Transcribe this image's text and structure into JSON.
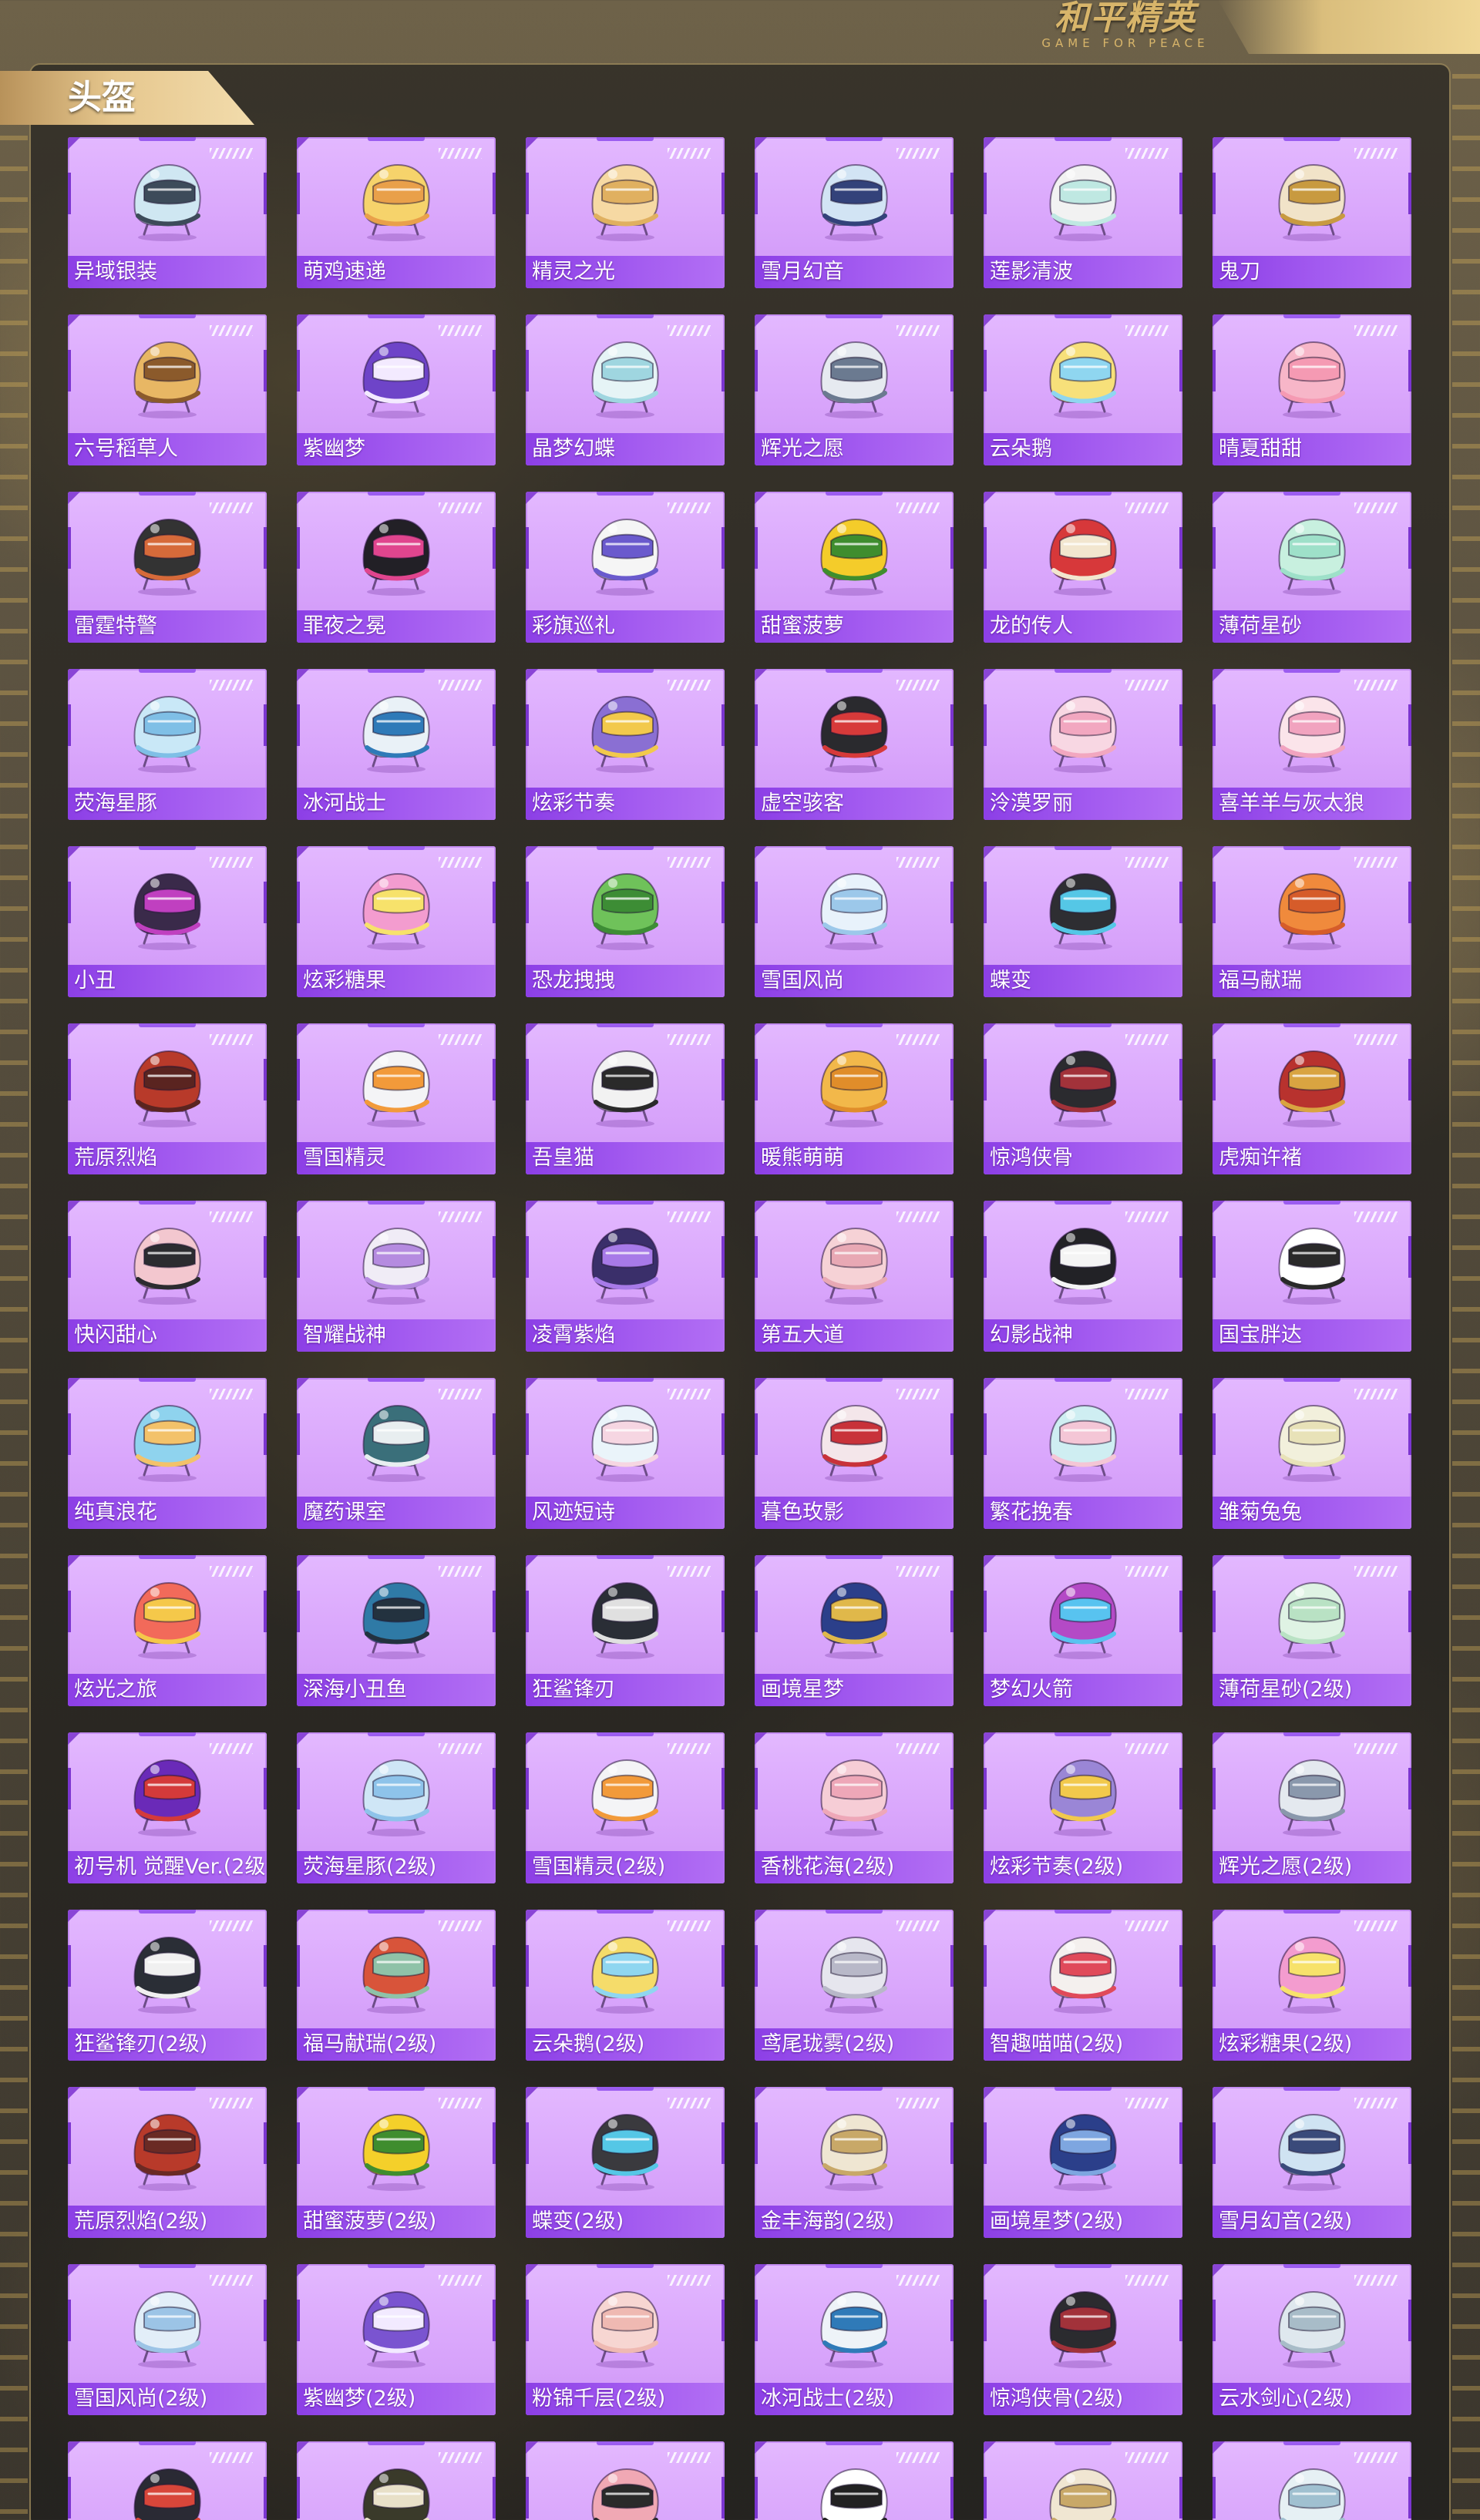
{
  "logo": {
    "title": "和平精英",
    "subtitle": "GAME FOR PEACE"
  },
  "section": {
    "title": "头盔"
  },
  "helmets": [
    {
      "name": "异域银装",
      "colors": [
        "#cfe7f2",
        "#3d4b5a"
      ]
    },
    {
      "name": "萌鸡速递",
      "colors": [
        "#f6d36b",
        "#e9a04a"
      ]
    },
    {
      "name": "精灵之光",
      "colors": [
        "#f6d9a3",
        "#e0b060"
      ]
    },
    {
      "name": "雪月幻音",
      "colors": [
        "#d2e4f4",
        "#33427a"
      ]
    },
    {
      "name": "莲影清波",
      "colors": [
        "#f2f2f2",
        "#bfe8e2"
      ]
    },
    {
      "name": "鬼刀",
      "colors": [
        "#f1e3c8",
        "#c89a40"
      ]
    },
    {
      "name": "六号稻草人",
      "colors": [
        "#e8b764",
        "#8b5a2b"
      ]
    },
    {
      "name": "紫幽梦",
      "colors": [
        "#6e44c8",
        "#f3eaff"
      ]
    },
    {
      "name": "晶梦幻蝶",
      "colors": [
        "#e6f4f6",
        "#9fd6e0"
      ]
    },
    {
      "name": "辉光之愿",
      "colors": [
        "#e6eaf0",
        "#6b7a90"
      ]
    },
    {
      "name": "云朵鹅",
      "colors": [
        "#f7e07a",
        "#8fd6f0"
      ]
    },
    {
      "name": "晴夏甜甜",
      "colors": [
        "#f7b6c8",
        "#f59ab3"
      ]
    },
    {
      "name": "雷霆特警",
      "colors": [
        "#333333",
        "#d66a3a"
      ]
    },
    {
      "name": "罪夜之冕",
      "colors": [
        "#222026",
        "#e0458e"
      ]
    },
    {
      "name": "彩旗巡礼",
      "colors": [
        "#f5f5f5",
        "#6a5acd"
      ]
    },
    {
      "name": "甜蜜菠萝",
      "colors": [
        "#f4cc2a",
        "#3f8d2e"
      ]
    },
    {
      "name": "龙的传人",
      "colors": [
        "#d7383a",
        "#f2e6cf"
      ]
    },
    {
      "name": "薄荷星砂",
      "colors": [
        "#c8f0df",
        "#9ee0c9"
      ]
    },
    {
      "name": "荧海星豚",
      "colors": [
        "#c9e8f7",
        "#7fbfe6"
      ]
    },
    {
      "name": "冰河战士",
      "colors": [
        "#e9f1f7",
        "#2f7ab8"
      ]
    },
    {
      "name": "炫彩节奏",
      "colors": [
        "#8a6fd3",
        "#f2c94c"
      ]
    },
    {
      "name": "虚空骇客",
      "colors": [
        "#2a2a2e",
        "#d73a3a"
      ]
    },
    {
      "name": "泠漠罗丽",
      "colors": [
        "#f8d7e3",
        "#f2a7c0"
      ]
    },
    {
      "name": "喜羊羊与灰太狼",
      "colors": [
        "#fbe4ea",
        "#f1a3bf"
      ]
    },
    {
      "name": "小丑",
      "colors": [
        "#3a2a4a",
        "#c040c0"
      ]
    },
    {
      "name": "炫彩糖果",
      "colors": [
        "#f39ccf",
        "#f7e26b"
      ]
    },
    {
      "name": "恐龙拽拽",
      "colors": [
        "#6fc25a",
        "#3d8d35"
      ]
    },
    {
      "name": "雪国风尚",
      "colors": [
        "#e8f2fb",
        "#9cc8ea"
      ]
    },
    {
      "name": "蝶变",
      "colors": [
        "#2e2e32",
        "#55c7e6"
      ]
    },
    {
      "name": "福马献瑞",
      "colors": [
        "#f08a3c",
        "#d65c2a"
      ]
    },
    {
      "name": "荒原烈焰",
      "colors": [
        "#b83a2a",
        "#5a2420"
      ]
    },
    {
      "name": "雪国精灵",
      "colors": [
        "#f4f4f6",
        "#f29a3a"
      ]
    },
    {
      "name": "吾皇猫",
      "colors": [
        "#f2f2f2",
        "#2a2a2a"
      ]
    },
    {
      "name": "暖熊萌萌",
      "colors": [
        "#f2b84a",
        "#e08d2a"
      ]
    },
    {
      "name": "惊鸿侠骨",
      "colors": [
        "#2b2b2f",
        "#a2323a"
      ]
    },
    {
      "name": "虎痴许褚",
      "colors": [
        "#b8322e",
        "#d9a441"
      ]
    },
    {
      "name": "快闪甜心",
      "colors": [
        "#f3c7cf",
        "#2c2c30"
      ]
    },
    {
      "name": "智耀战神",
      "colors": [
        "#f0ecf6",
        "#b58be0"
      ]
    },
    {
      "name": "凌霄紫焰",
      "colors": [
        "#3a2f6a",
        "#a77ae8"
      ]
    },
    {
      "name": "第五大道",
      "colors": [
        "#f6d2d6",
        "#e8a8b4"
      ]
    },
    {
      "name": "幻影战神",
      "colors": [
        "#222226",
        "#f4f4f4"
      ]
    },
    {
      "name": "国宝胖达",
      "colors": [
        "#ffffff",
        "#2a2a2a"
      ]
    },
    {
      "name": "纯真浪花",
      "colors": [
        "#8fd3ee",
        "#f3c26a"
      ]
    },
    {
      "name": "魔药课室",
      "colors": [
        "#3a6f7a",
        "#e8eef0"
      ]
    },
    {
      "name": "风迹短诗",
      "colors": [
        "#eaf4fa",
        "#f6d6e2"
      ]
    },
    {
      "name": "暮色玫影",
      "colors": [
        "#f4e6ea",
        "#c8323a"
      ]
    },
    {
      "name": "繁花挽春",
      "colors": [
        "#cfeef2",
        "#f4c6d6"
      ]
    },
    {
      "name": "雏菊兔兔",
      "colors": [
        "#f2f0dc",
        "#e8e2b8"
      ]
    },
    {
      "name": "炫光之旅",
      "colors": [
        "#f26a5a",
        "#f5c84a"
      ]
    },
    {
      "name": "深海小丑鱼",
      "colors": [
        "#2f7aa6",
        "#23323f"
      ]
    },
    {
      "name": "狂鲨锋刃",
      "colors": [
        "#2a2e36",
        "#e0e0e0"
      ]
    },
    {
      "name": "画境星梦",
      "colors": [
        "#2b3f8a",
        "#e0b84a"
      ]
    },
    {
      "name": "梦幻火箭",
      "colors": [
        "#b44ac6",
        "#58c3f0"
      ]
    },
    {
      "name": "薄荷星砂(2级)",
      "colors": [
        "#dff3e4",
        "#b9e2c4"
      ]
    },
    {
      "name": "初号机 觉醒Ver.(2级)",
      "colors": [
        "#6a2ab8",
        "#d43a3a"
      ]
    },
    {
      "name": "荧海星豚(2级)",
      "colors": [
        "#cfe6f6",
        "#8ec3ea"
      ]
    },
    {
      "name": "雪国精灵(2级)",
      "colors": [
        "#f4f4f6",
        "#f29a3a"
      ]
    },
    {
      "name": "香桃花海(2级)",
      "colors": [
        "#f6cdd6",
        "#eea7b8"
      ]
    },
    {
      "name": "炫彩节奏(2级)",
      "colors": [
        "#9a86d6",
        "#f2c94c"
      ]
    },
    {
      "name": "辉光之愿(2级)",
      "colors": [
        "#e4e9ef",
        "#8a98ac"
      ]
    },
    {
      "name": "狂鲨锋刃(2级)",
      "colors": [
        "#2a2e36",
        "#f0f0f0"
      ]
    },
    {
      "name": "福马献瑞(2级)",
      "colors": [
        "#d8543a",
        "#8fc2a8"
      ]
    },
    {
      "name": "云朵鹅(2级)",
      "colors": [
        "#f5dc6a",
        "#8fd6f0"
      ]
    },
    {
      "name": "鸢尾珑雾(2级)",
      "colors": [
        "#e6e6ee",
        "#b8b8c8"
      ]
    },
    {
      "name": "智趣喵喵(2级)",
      "colors": [
        "#f4f0ee",
        "#e04a5a"
      ]
    },
    {
      "name": "炫彩糖果(2级)",
      "colors": [
        "#f39ccf",
        "#f7e26b"
      ]
    },
    {
      "name": "荒原烈焰(2级)",
      "colors": [
        "#b83a2a",
        "#6a2a24"
      ]
    },
    {
      "name": "甜蜜菠萝(2级)",
      "colors": [
        "#f4d02a",
        "#3f8d2e"
      ]
    },
    {
      "name": "蝶变(2级)",
      "colors": [
        "#3a3a3e",
        "#55c7e6"
      ]
    },
    {
      "name": "金丰海韵(2级)",
      "colors": [
        "#efe6d2",
        "#c8a868"
      ]
    },
    {
      "name": "画境星梦(2级)",
      "colors": [
        "#2b3f8a",
        "#7ea6e0"
      ]
    },
    {
      "name": "雪月幻音(2级)",
      "colors": [
        "#cfe3f2",
        "#3a4a7a"
      ]
    },
    {
      "name": "雪国风尚(2级)",
      "colors": [
        "#e2eef8",
        "#9cc4e6"
      ]
    },
    {
      "name": "紫幽梦(2级)",
      "colors": [
        "#7a54d0",
        "#f2eaff"
      ]
    },
    {
      "name": "粉锦千层(2级)",
      "colors": [
        "#f7d6d2",
        "#efb9b2"
      ]
    },
    {
      "name": "冰河战士(2级)",
      "colors": [
        "#eef3f8",
        "#2f7ab8"
      ]
    },
    {
      "name": "惊鸿侠骨(2级)",
      "colors": [
        "#2b2b2f",
        "#a2323a"
      ]
    },
    {
      "name": "云水剑心(2级)",
      "colors": [
        "#dfe8ee",
        "#a8bcc8"
      ]
    },
    {
      "name": "",
      "colors": [
        "#2a2a34",
        "#d8463a"
      ]
    },
    {
      "name": "",
      "colors": [
        "#3a3a2a",
        "#e8e0c8"
      ]
    },
    {
      "name": "",
      "colors": [
        "#f0a8b4",
        "#2a2a2a"
      ]
    },
    {
      "name": "",
      "colors": [
        "#ffffff",
        "#222222"
      ]
    },
    {
      "name": "",
      "colors": [
        "#f0e6d2",
        "#c8a868"
      ]
    },
    {
      "name": "",
      "colors": [
        "#e6f0f4",
        "#a0c0d0"
      ]
    }
  ]
}
